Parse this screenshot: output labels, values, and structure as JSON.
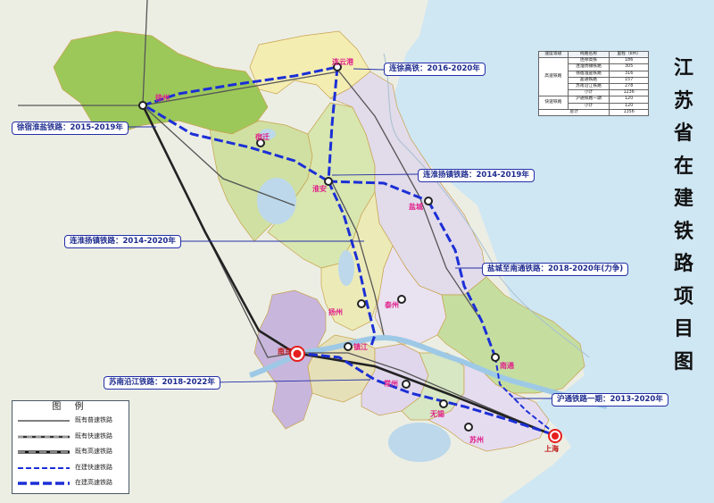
{
  "title_chars": [
    "江",
    "苏",
    "省",
    "在",
    "建",
    "铁",
    "路",
    "项",
    "目",
    "图"
  ],
  "callouts": {
    "lianxu": "连徐高铁：2016-2020年",
    "xusuhuaiyan": "徐宿淮盐铁路：2015-2019年",
    "lianhuaiyangzhen_1": "连淮扬镇铁路：2014-2019年",
    "lianhuaiyangzhen_2": "连淮扬镇铁路：2014-2020年",
    "yanchengnantong": "盐城至南通铁路：2018-2020年(力争)",
    "sunanyanjiang": "苏南沿江铁路：2018-2022年",
    "hutong": "沪通铁路一期：2013-2020年"
  },
  "cities": {
    "lianyungang": "连云港",
    "xuzhou": "徐州",
    "suqian": "宿迁",
    "huaian": "淮安",
    "yancheng": "盐城",
    "yangzhou": "扬州",
    "taizhou": "泰州",
    "zhenjiang": "镇江",
    "nanjing": "南京",
    "changzhou": "常州",
    "wuxi": "无锡",
    "suzhou": "苏州",
    "nantong": "南通",
    "shanghai": "上海"
  },
  "summary_table": {
    "headers": [
      "速度等级",
      "线路名称",
      "里程（km）"
    ],
    "groups": [
      {
        "grade": "高速铁路",
        "rows": [
          {
            "name": "连徐高铁",
            "km": "186"
          },
          {
            "name": "连淮扬镇铁路",
            "km": "305"
          },
          {
            "name": "徐宿淮盐铁路",
            "km": "316"
          },
          {
            "name": "盐通铁路",
            "km": "157"
          },
          {
            "name": "苏南沿江铁路",
            "km": "278"
          },
          {
            "name": "小计",
            "km": "1236"
          }
        ]
      },
      {
        "grade": "快速铁路",
        "rows": [
          {
            "name": "沪通铁路一期",
            "km": "120"
          },
          {
            "name": "小计",
            "km": "120"
          }
        ]
      }
    ],
    "total_label": "总计",
    "total_km": "1356"
  },
  "legend": {
    "title": "图 例",
    "items": [
      {
        "label": "既有普速铁路",
        "style": "normal"
      },
      {
        "label": "既有快速铁路",
        "style": "existing-fast"
      },
      {
        "label": "既有高速铁路",
        "style": "existing-high"
      },
      {
        "label": "在建快速铁路",
        "style": "building-fast"
      },
      {
        "label": "在建高速铁路",
        "style": "building-high"
      }
    ]
  },
  "colors": {
    "sea": "#cfe6f3",
    "land_outside": "#eceee4",
    "xuzhou_region": "#9cc85a",
    "lianyungang_region": "#f4edb2",
    "suqian_region": "#cfe0a2",
    "huaian_region": "#d8e6b0",
    "yancheng_region": "#e1dbea",
    "yangzhou_region": "#ecebb8",
    "taizhou_region": "#e9e2f1",
    "nantong_region": "#c5dea0",
    "nanjing_region": "#c8b6dc",
    "zhenjiang_region": "#e6e0b8",
    "changzhou_region": "#e0d7ec",
    "wuxi_region": "#d7e6c3",
    "suzhou_region": "#e6dcf0",
    "building_line": "#1b2fd6",
    "callout_border": "#2430a8",
    "capital_marker": "#e61e1e"
  }
}
